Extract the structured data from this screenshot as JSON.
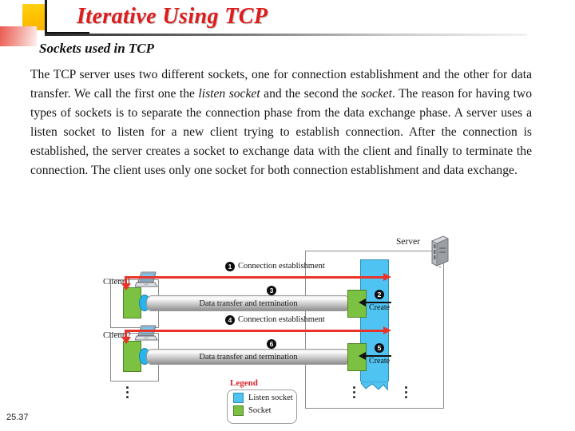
{
  "slide": {
    "title": "Iterative Using TCP",
    "subtitle": "Sockets used in TCP",
    "page_number": "25.37",
    "accent_color": "#e01b1b",
    "title_rule_color": "#2b2b2b"
  },
  "body": {
    "paragraph_parts": {
      "p1": "The TCP server uses two different sockets, one for connection establishment and the other for data transfer. We call the first one the ",
      "em1": "listen socket",
      "p2": " and the second the ",
      "em2": "socket",
      "p3": ". The reason for having two types of sockets is to separate the connection phase from the data exchange phase. A server uses a listen socket to listen for a new client  trying to establish connection.  After the connection is established, the server creates a socket to exchange data with the client and finally to terminate the connection.  The client uses only one socket for both connection establishment and data exchange."
    }
  },
  "figure": {
    "clients": [
      {
        "label": "Client 1"
      },
      {
        "label": "Client 2"
      }
    ],
    "server": {
      "label": "Server"
    },
    "steps": [
      {
        "num": "1",
        "glyph": "❶",
        "label": "Connection establishment"
      },
      {
        "num": "2",
        "glyph": "❷",
        "label": "Create"
      },
      {
        "num": "3",
        "glyph": "❸",
        "label": "Data transfer and termination"
      },
      {
        "num": "4",
        "glyph": "❹",
        "label": "Connection establishment"
      },
      {
        "num": "5",
        "glyph": "❺",
        "label": "Create"
      },
      {
        "num": "6",
        "glyph": "❻",
        "label": "Data transfer and termination"
      }
    ],
    "pipe_label": "Data transfer and termination",
    "create_label": "Create",
    "legend": {
      "title": "Legend",
      "items": [
        {
          "label": "Listen socket",
          "color": "#4fc3f2"
        },
        {
          "label": "Socket",
          "color": "#7cc242"
        }
      ]
    }
  }
}
